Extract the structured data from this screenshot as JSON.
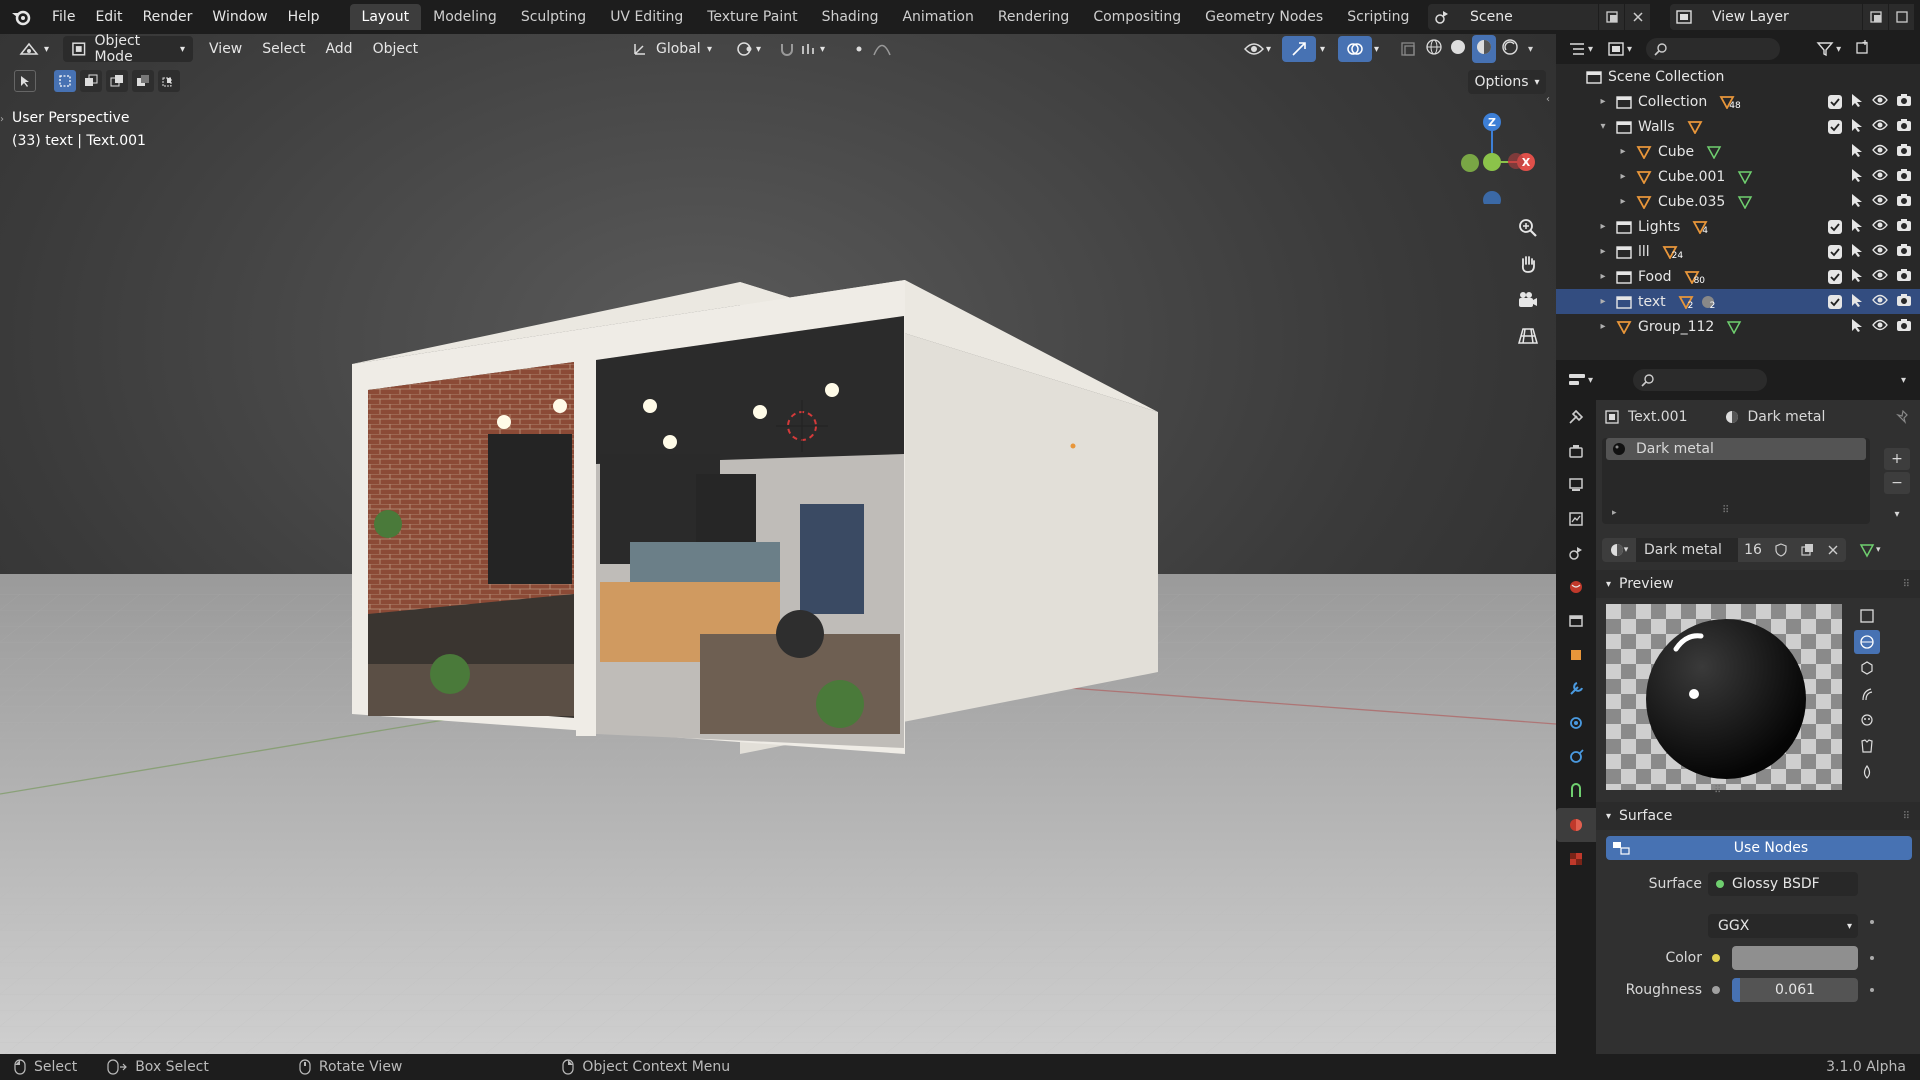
{
  "menubar": {
    "file": "File",
    "edit": "Edit",
    "render": "Render",
    "window": "Window",
    "help": "Help"
  },
  "workspaces": [
    "Layout",
    "Modeling",
    "Sculpting",
    "UV Editing",
    "Texture Paint",
    "Shading",
    "Animation",
    "Rendering",
    "Compositing",
    "Geometry Nodes",
    "Scripting"
  ],
  "active_workspace": "Layout",
  "scene": {
    "name": "Scene"
  },
  "view_layer": {
    "name": "View Layer"
  },
  "viewport": {
    "mode": "Object Mode",
    "menus": {
      "view": "View",
      "select": "Select",
      "add": "Add",
      "object": "Object"
    },
    "transform_orientation": "Global",
    "options_label": "Options",
    "perspective_label": "User Perspective",
    "object_label": "(33) text | Text.001",
    "gizmo": {
      "z": "Z",
      "x": "X"
    }
  },
  "outliner": {
    "root": "Scene Collection",
    "rows": [
      {
        "name": "Collection",
        "badge": "48"
      },
      {
        "name": "Walls",
        "badge": ""
      },
      {
        "name": "Cube",
        "badge": ""
      },
      {
        "name": "Cube.001",
        "badge": ""
      },
      {
        "name": "Cube.035",
        "badge": ""
      },
      {
        "name": "Lights",
        "badge": "4"
      },
      {
        "name": "lll",
        "badge": "24"
      },
      {
        "name": "Food",
        "badge": "80"
      },
      {
        "name": "text",
        "badge": "2",
        "badge2": "2"
      },
      {
        "name": "Group_112",
        "badge": ""
      }
    ],
    "selected": "text"
  },
  "properties": {
    "object_name": "Text.001",
    "material_name": "Dark metal",
    "slot_material": "Dark metal",
    "material_users": "16",
    "preview_label": "Preview",
    "surface_label": "Surface",
    "use_nodes_label": "Use Nodes",
    "surface_field_label": "Surface",
    "surface_shader": "Glossy BSDF",
    "distribution": "GGX",
    "color_label": "Color",
    "roughness_label": "Roughness",
    "roughness_value": "0.061",
    "roughness_fraction": 0.061
  },
  "statusbar": {
    "select": "Select",
    "box_select": "Box Select",
    "rotate_view": "Rotate View",
    "context_menu": "Object Context Menu",
    "version": "3.1.0 Alpha"
  },
  "colors": {
    "accent": "#4772b3",
    "selected_row": "#334d80",
    "axis_x": "#e0504a",
    "axis_y": "#8bc34a",
    "axis_z": "#3d7fd6",
    "collection_icon": "#e6e6e6",
    "object_icon": "#e8963a",
    "mesh_icon": "#6fcf6f"
  }
}
